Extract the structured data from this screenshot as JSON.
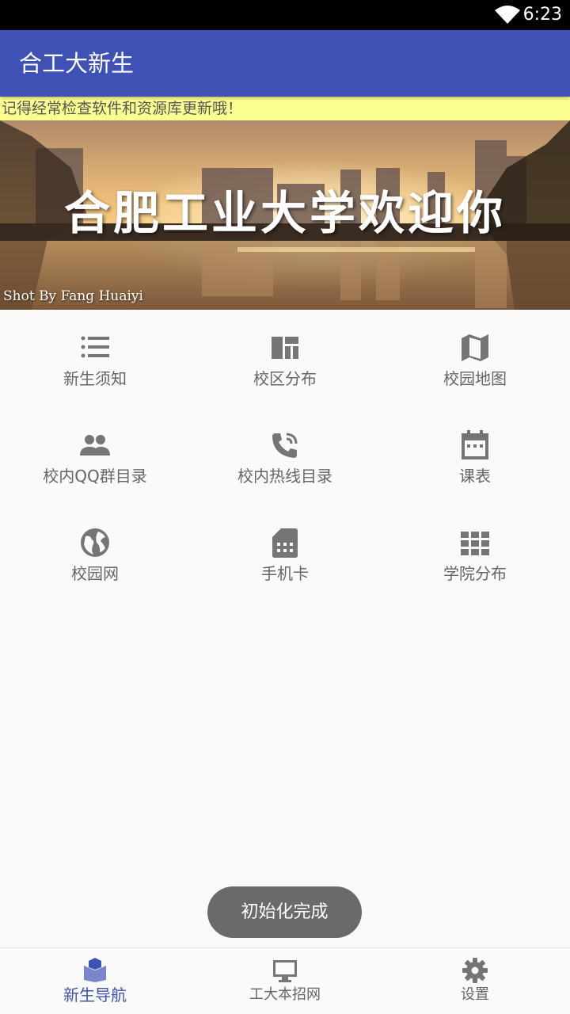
{
  "status_bar": {
    "time": "6:23",
    "wifi_icon": "wifi-icon"
  },
  "app_bar": {
    "title": "合工大新生"
  },
  "notice": {
    "text": "记得经常检查软件和资源库更新哦！"
  },
  "banner": {
    "headline": "合肥工业大学欢迎你",
    "credit": "Shot By Fang Huaiyi"
  },
  "grid": {
    "items": [
      {
        "label": "新生须知",
        "icon": "list-icon"
      },
      {
        "label": "校区分布",
        "icon": "dashboard-icon"
      },
      {
        "label": "校园地图",
        "icon": "map-icon"
      },
      {
        "label": "校内QQ群目录",
        "icon": "people-icon"
      },
      {
        "label": "校内热线目录",
        "icon": "phone-in-talk-icon"
      },
      {
        "label": "课表",
        "icon": "calendar-icon"
      },
      {
        "label": "校园网",
        "icon": "globe-icon"
      },
      {
        "label": "手机卡",
        "icon": "sim-card-icon"
      },
      {
        "label": "学院分布",
        "icon": "apps-grid-icon"
      }
    ]
  },
  "toast": {
    "text": "初始化完成"
  },
  "bottom_nav": {
    "items": [
      {
        "label": "新生导航",
        "icon": "book-icon",
        "active": true
      },
      {
        "label": "工大本招网",
        "icon": "monitor-icon",
        "active": false
      },
      {
        "label": "设置",
        "icon": "gear-icon",
        "active": false
      }
    ],
    "active_color": "#3f51b5"
  },
  "colors": {
    "app_bar": "#3f51b5",
    "notice_bg": "#fcff8f",
    "icon_grey": "#757575"
  }
}
